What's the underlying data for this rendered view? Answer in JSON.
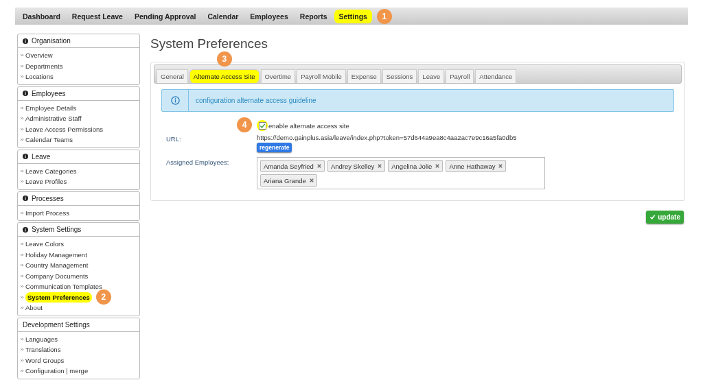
{
  "nav": [
    {
      "label": "Dashboard",
      "selected": false
    },
    {
      "label": "Request Leave",
      "selected": false
    },
    {
      "label": "Pending Approval",
      "selected": false
    },
    {
      "label": "Calendar",
      "selected": false
    },
    {
      "label": "Employees",
      "selected": false
    },
    {
      "label": "Reports",
      "selected": false
    },
    {
      "label": "Settings",
      "selected": true,
      "callout": "1"
    }
  ],
  "sidebar": [
    {
      "title": "Organisation",
      "info_icon": true,
      "items": [
        {
          "label": "Overview",
          "selected": false
        },
        {
          "label": "Departments",
          "selected": false
        },
        {
          "label": "Locations",
          "selected": false
        }
      ]
    },
    {
      "title": "Employees",
      "info_icon": true,
      "items": [
        {
          "label": "Employee Details",
          "selected": false
        },
        {
          "label": "Administrative Staff",
          "selected": false
        },
        {
          "label": "Leave Access Permissions",
          "selected": false
        },
        {
          "label": "Calendar Teams",
          "selected": false
        }
      ]
    },
    {
      "title": "Leave",
      "info_icon": true,
      "items": [
        {
          "label": "Leave Categories",
          "selected": false
        },
        {
          "label": "Leave Profiles",
          "selected": false
        }
      ]
    },
    {
      "title": "Processes",
      "info_icon": true,
      "items": [
        {
          "label": "Import Process",
          "selected": false
        }
      ]
    },
    {
      "title": "System Settings",
      "info_icon": true,
      "items": [
        {
          "label": "Leave Colors",
          "selected": false
        },
        {
          "label": "Holiday Management",
          "selected": false
        },
        {
          "label": "Country Management",
          "selected": false
        },
        {
          "label": "Company Documents",
          "selected": false
        },
        {
          "label": "Communication Templates",
          "selected": false
        },
        {
          "label": "System Preferences",
          "selected": true,
          "callout": "2"
        },
        {
          "label": "About",
          "selected": false
        }
      ]
    },
    {
      "title": "Development Settings",
      "info_icon": false,
      "items": [
        {
          "label": "Languages",
          "selected": false
        },
        {
          "label": "Translations",
          "selected": false
        },
        {
          "label": "Word Groups",
          "selected": false
        },
        {
          "label": "Configuration | merge",
          "selected": false
        }
      ]
    }
  ],
  "page_title": "System Preferences",
  "tabs": [
    {
      "label": "General",
      "selected": false
    },
    {
      "label": "Alternate Access Site",
      "selected": true,
      "callout": "3"
    },
    {
      "label": "Overtime",
      "selected": false
    },
    {
      "label": "Payroll Mobile",
      "selected": false
    },
    {
      "label": "Expense",
      "selected": false
    },
    {
      "label": "Sessions",
      "selected": false
    },
    {
      "label": "Leave",
      "selected": false
    },
    {
      "label": "Payroll",
      "selected": false
    },
    {
      "label": "Attendance",
      "selected": false
    }
  ],
  "info_banner": "configuration alternate access guideline",
  "enable": {
    "label": "enable alternate access site",
    "checked": true,
    "callout": "4"
  },
  "url_label": "URL:",
  "url": "https://demo.gainplus.asia/leave/index.php?token=57d644a9ea8c4aa2ac7e9c16a5fa0db5",
  "regenerate_button": "regenerate",
  "assigned_label": "Assigned Employees:",
  "assigned": [
    "Amanda Seyfried",
    "Andrey Skelley",
    "Angelina Jolie",
    "Anne Hathaway",
    "Ariana Grande"
  ],
  "update_button": "update"
}
